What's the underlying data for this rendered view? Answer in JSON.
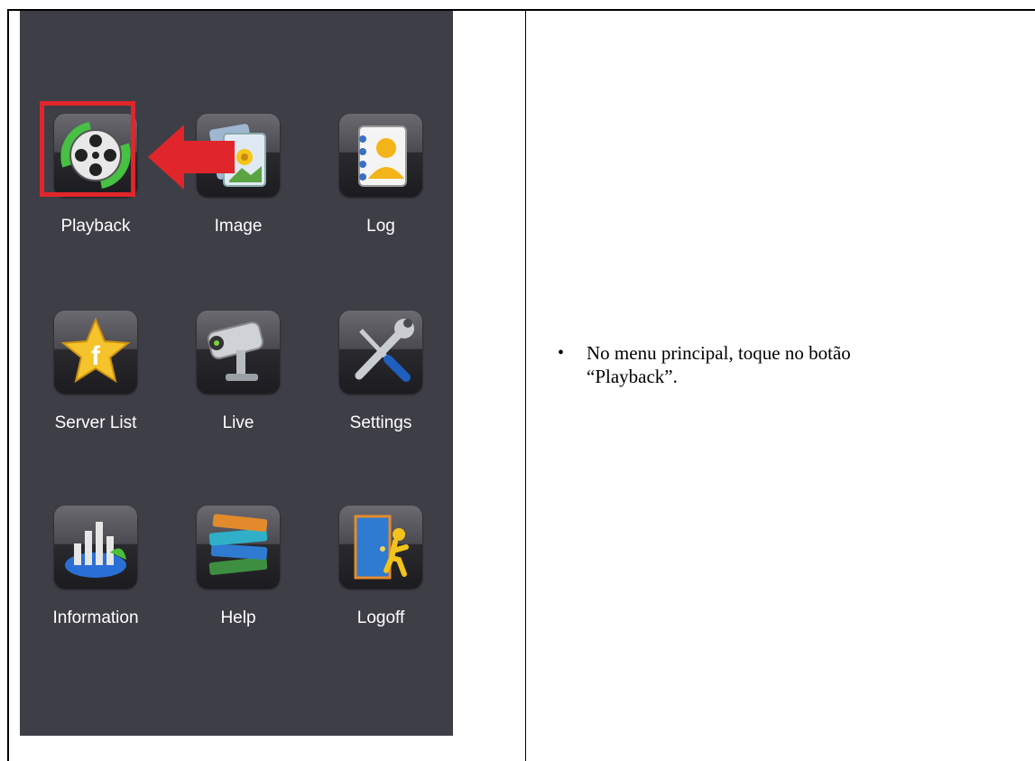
{
  "menu": {
    "items": [
      {
        "label": "Playback",
        "icon": "playback-film-reel-icon"
      },
      {
        "label": "Image",
        "icon": "image-gallery-icon"
      },
      {
        "label": "Log",
        "icon": "log-contacts-icon"
      },
      {
        "label": "Server List",
        "icon": "server-list-star-icon"
      },
      {
        "label": "Live",
        "icon": "live-camera-icon"
      },
      {
        "label": "Settings",
        "icon": "settings-tools-icon"
      },
      {
        "label": "Information",
        "icon": "information-chart-icon"
      },
      {
        "label": "Help",
        "icon": "help-books-icon"
      },
      {
        "label": "Logoff",
        "icon": "logoff-door-icon"
      }
    ],
    "highlighted": "Playback",
    "highlight_color": "#e0262a",
    "background_color": "#3e3e47"
  },
  "instruction": {
    "bullet": "•",
    "text": "No menu principal, toque no botão\n“Playback”."
  }
}
